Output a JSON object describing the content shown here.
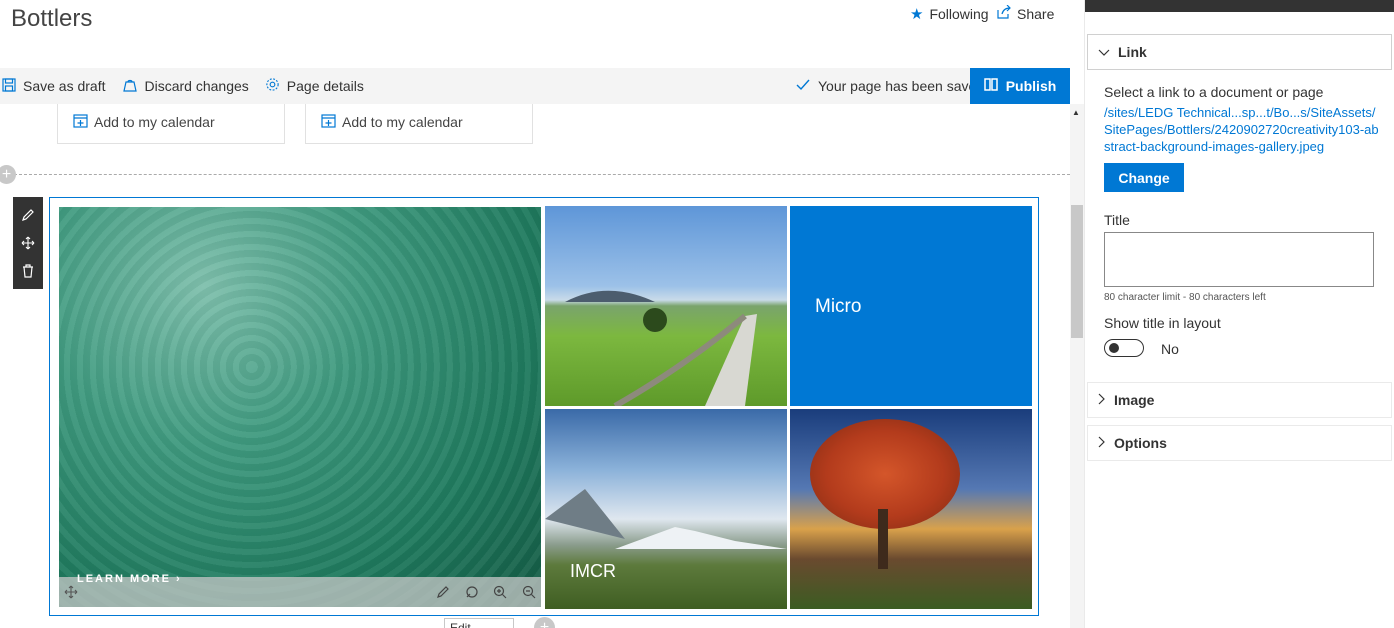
{
  "header": {
    "site_title": "Bottlers",
    "following_label": "Following",
    "share_label": "Share"
  },
  "command_bar": {
    "save_draft": "Save as draft",
    "discard": "Discard changes",
    "page_details": "Page details",
    "saved_status": "Your page has been saved",
    "publish": "Publish"
  },
  "events": {
    "cards": [
      {
        "label": "Add to my calendar"
      },
      {
        "label": "Add to my calendar"
      }
    ]
  },
  "gallery": {
    "learn_more": "LEARN MORE",
    "tile_micro": "Micro",
    "tile_imcr": "IMCR",
    "edit_details": "Edit details"
  },
  "panel": {
    "link_section": "Link",
    "link_description": "Select a link to a document or page",
    "link_url": "/sites/LEDG Technical...sp...t/Bo...s/SiteAssets/SitePages/Bottlers/2420902720creativity103-abstract-background-images-gallery.jpeg",
    "change_button": "Change",
    "title_label": "Title",
    "title_value": "",
    "char_limit": "80 character limit - 80 characters left",
    "show_title_label": "Show title in layout",
    "show_title_state": "No",
    "image_section": "Image",
    "options_section": "Options"
  },
  "colors": {
    "accent": "#0078d4",
    "toolbar_bg": "#333333",
    "command_bg": "#f4f4f4"
  }
}
